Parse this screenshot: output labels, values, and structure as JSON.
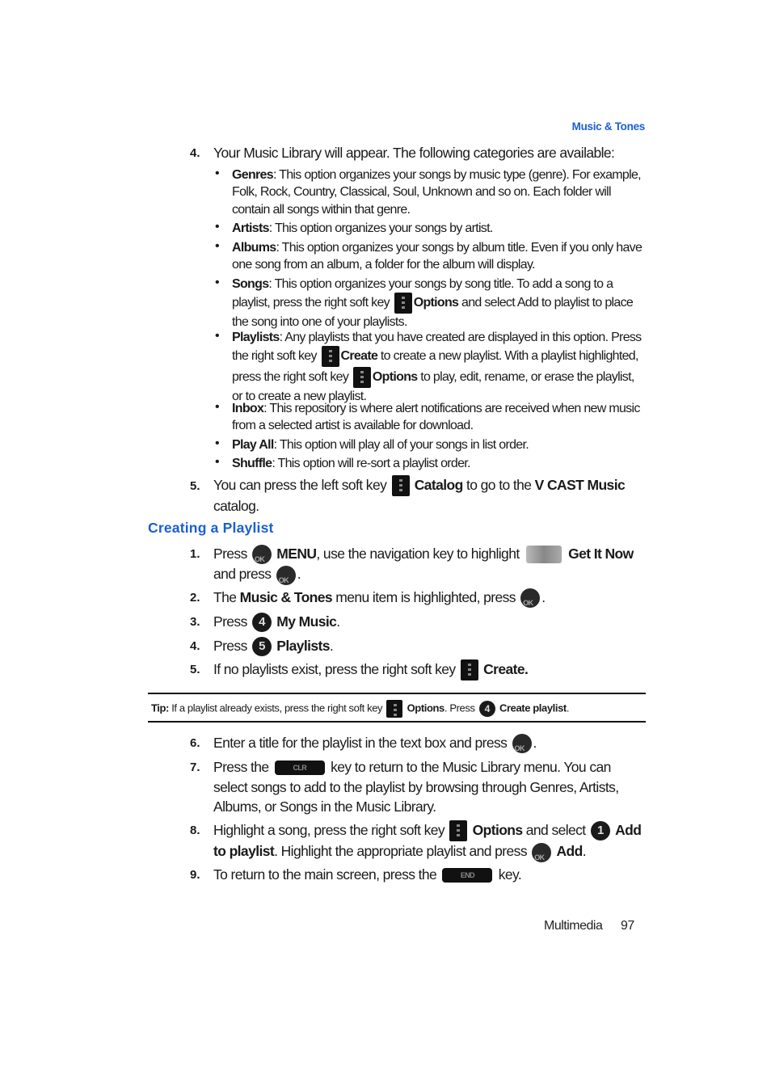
{
  "header": {
    "section_title": "Music & Tones"
  },
  "step4": {
    "num": "4.",
    "text": "Your Music Library will appear. The following categories are available:",
    "bullets": [
      {
        "term": "Genres",
        "rest": ": This option organizes your songs by music type (genre). For example, Folk, Rock, Country, Classical, Soul, Unknown and so on. Each folder will contain all songs within that genre."
      },
      {
        "term": "Artists",
        "rest": ": This option organizes your songs by artist."
      },
      {
        "term": "Albums",
        "rest": ": This option organizes your songs by album title. Even if you only have one song from an album, a folder for the album will display."
      },
      {
        "term": "Songs",
        "rest_a": ": This option organizes your songs by song title. To add a song to a playlist, press the right soft key",
        "key": "Options",
        "rest_b": "and select Add to playlist to place the song into one of your playlists."
      },
      {
        "term": "Playlists",
        "rest_a": ": Any playlists that you have created are displayed in this option. Press the right soft key",
        "key1": "Create",
        "rest_b": "to create a new playlist. With a playlist highlighted, press the right soft key",
        "key2": "Options",
        "rest_c": "to play, edit, rename, or erase the playlist, or to create a new playlist."
      },
      {
        "term": "Inbox",
        "rest": ": This repository is where alert notifications are received when new music from a selected artist is available for download."
      },
      {
        "term": "Play All",
        "rest": ": This option will play all of your songs in list order."
      },
      {
        "term": "Shuffle",
        "rest": ": This option will re-sort a playlist order."
      }
    ]
  },
  "step5a": {
    "num": "5.",
    "a": "You can press the left soft key",
    "key": "Catalog",
    "b": "to go to the",
    "c": "V CAST Music",
    "d": "catalog."
  },
  "section": {
    "title": "Creating a Playlist"
  },
  "steps": {
    "s1": {
      "num": "1.",
      "a": "Press",
      "k1": "MENU",
      "b": ", use the navigation key to highlight",
      "k2": "Get It Now",
      "c": "and press",
      "d": "."
    },
    "s2": {
      "num": "2.",
      "a": "The",
      "k": "Music & Tones",
      "b": "menu item is highlighted, press",
      "c": "."
    },
    "s3": {
      "num": "3.",
      "a": "Press",
      "digit": "4",
      "k": "My Music",
      "b": "."
    },
    "s4": {
      "num": "4.",
      "a": "Press",
      "digit": "5",
      "k": "Playlists",
      "b": "."
    },
    "s5": {
      "num": "5.",
      "a": "If no playlists exist, press the right soft key",
      "k": "Create."
    },
    "s6": {
      "num": "6.",
      "a": "Enter a title for the playlist in the text box and press",
      "b": "."
    },
    "s7": {
      "num": "7.",
      "a": "Press the",
      "key_label": "CLR",
      "b": "key to return to the Music Library menu. You can select songs to add to the playlist by browsing through Genres, Artists, Albums, or Songs in the Music Library."
    },
    "s8": {
      "num": "8.",
      "a": "Highlight a song, press the right soft key",
      "k1": "Options",
      "b": "and select",
      "digit": "1",
      "k2": "Add to playlist",
      "c": ". Highlight the appropriate playlist and press",
      "k3": "Add",
      "d": "."
    },
    "s9": {
      "num": "9.",
      "a": "To return to the main screen, press the",
      "key_label": "END",
      "b": "key."
    }
  },
  "tip": {
    "label": "Tip:",
    "a": "If a playlist already exists, press the right soft key",
    "k1": "Options",
    "b": ". Press",
    "digit": "4",
    "k2": "Create playlist",
    "c": "."
  },
  "footer": {
    "chapter": "Multimedia",
    "page": "97"
  }
}
